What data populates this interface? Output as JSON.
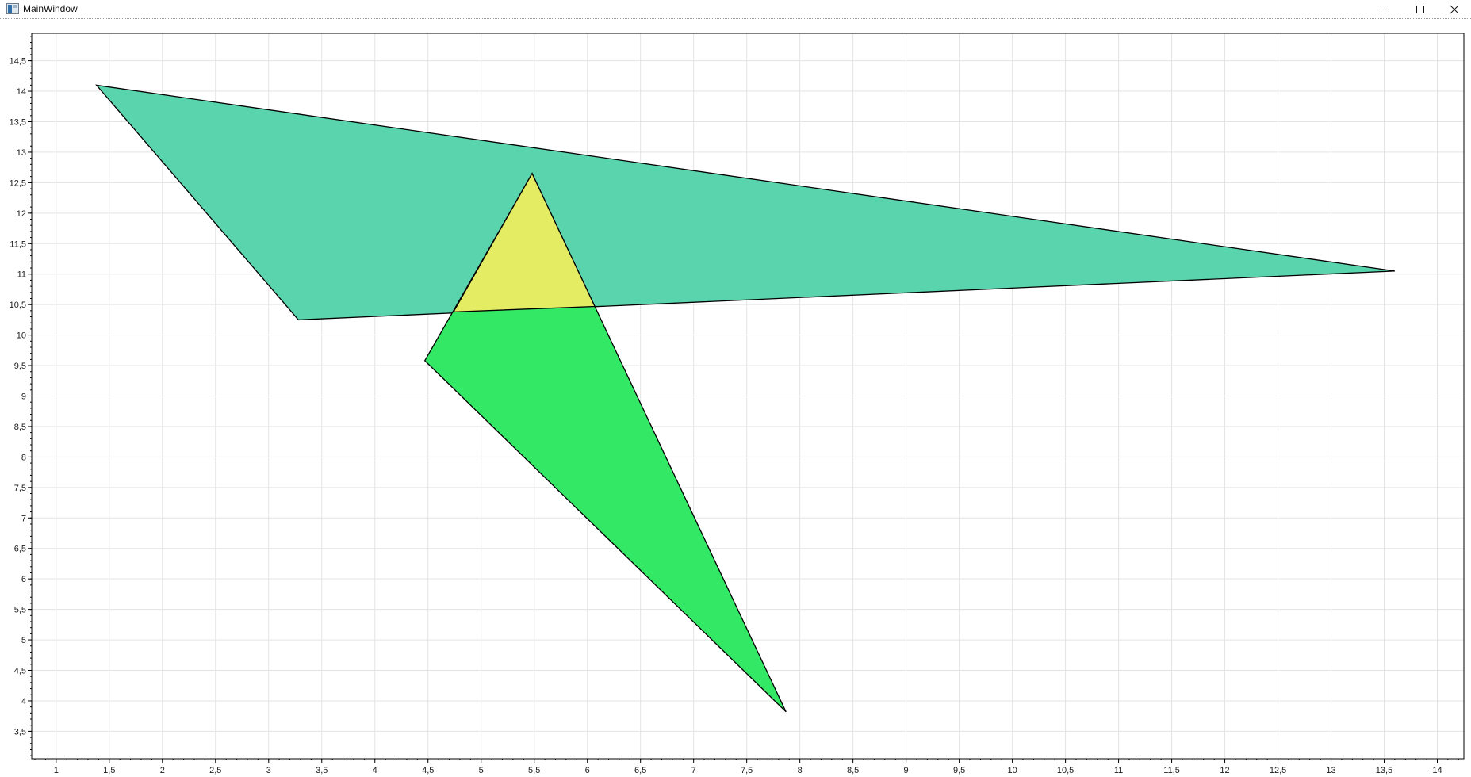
{
  "window": {
    "title": "MainWindow",
    "controls": {
      "minimize": "minimize-icon",
      "maximize": "maximize-icon",
      "close": "close-icon"
    }
  },
  "chart_data": {
    "type": "area",
    "xlim": [
      0.77,
      14.25
    ],
    "ylim": [
      3.05,
      14.95
    ],
    "grid": true,
    "x_ticks": [
      "1",
      "1,5",
      "2",
      "2,5",
      "3",
      "3,5",
      "4",
      "4,5",
      "5",
      "5,5",
      "6",
      "6,5",
      "7",
      "7,5",
      "8",
      "8,5",
      "9",
      "9,5",
      "10",
      "10,5",
      "11",
      "11,5",
      "12",
      "12,5",
      "13",
      "13,5",
      "14"
    ],
    "y_ticks": [
      "3,5",
      "4",
      "4,5",
      "5",
      "5,5",
      "6",
      "6,5",
      "7",
      "7,5",
      "8",
      "8,5",
      "9",
      "9,5",
      "10",
      "10,5",
      "11",
      "11,5",
      "12",
      "12,5",
      "13",
      "13,5",
      "14",
      "14,5"
    ],
    "polygons": [
      {
        "points": [
          [
            1.38,
            14.1
          ],
          [
            13.6,
            11.05
          ],
          [
            3.28,
            10.25
          ]
        ],
        "fill": "#5ad4ad",
        "stroke": "#000000"
      },
      {
        "points": [
          [
            5.48,
            12.65
          ],
          [
            7.87,
            3.82
          ],
          [
            4.47,
            9.58
          ]
        ],
        "fill": "#33e865",
        "stroke": "#000000"
      },
      {
        "points": [
          [
            5.48,
            12.65
          ],
          [
            6.07,
            10.47
          ],
          [
            4.74,
            10.38
          ]
        ],
        "fill": "#e4ec63",
        "stroke": "#000000"
      }
    ]
  }
}
